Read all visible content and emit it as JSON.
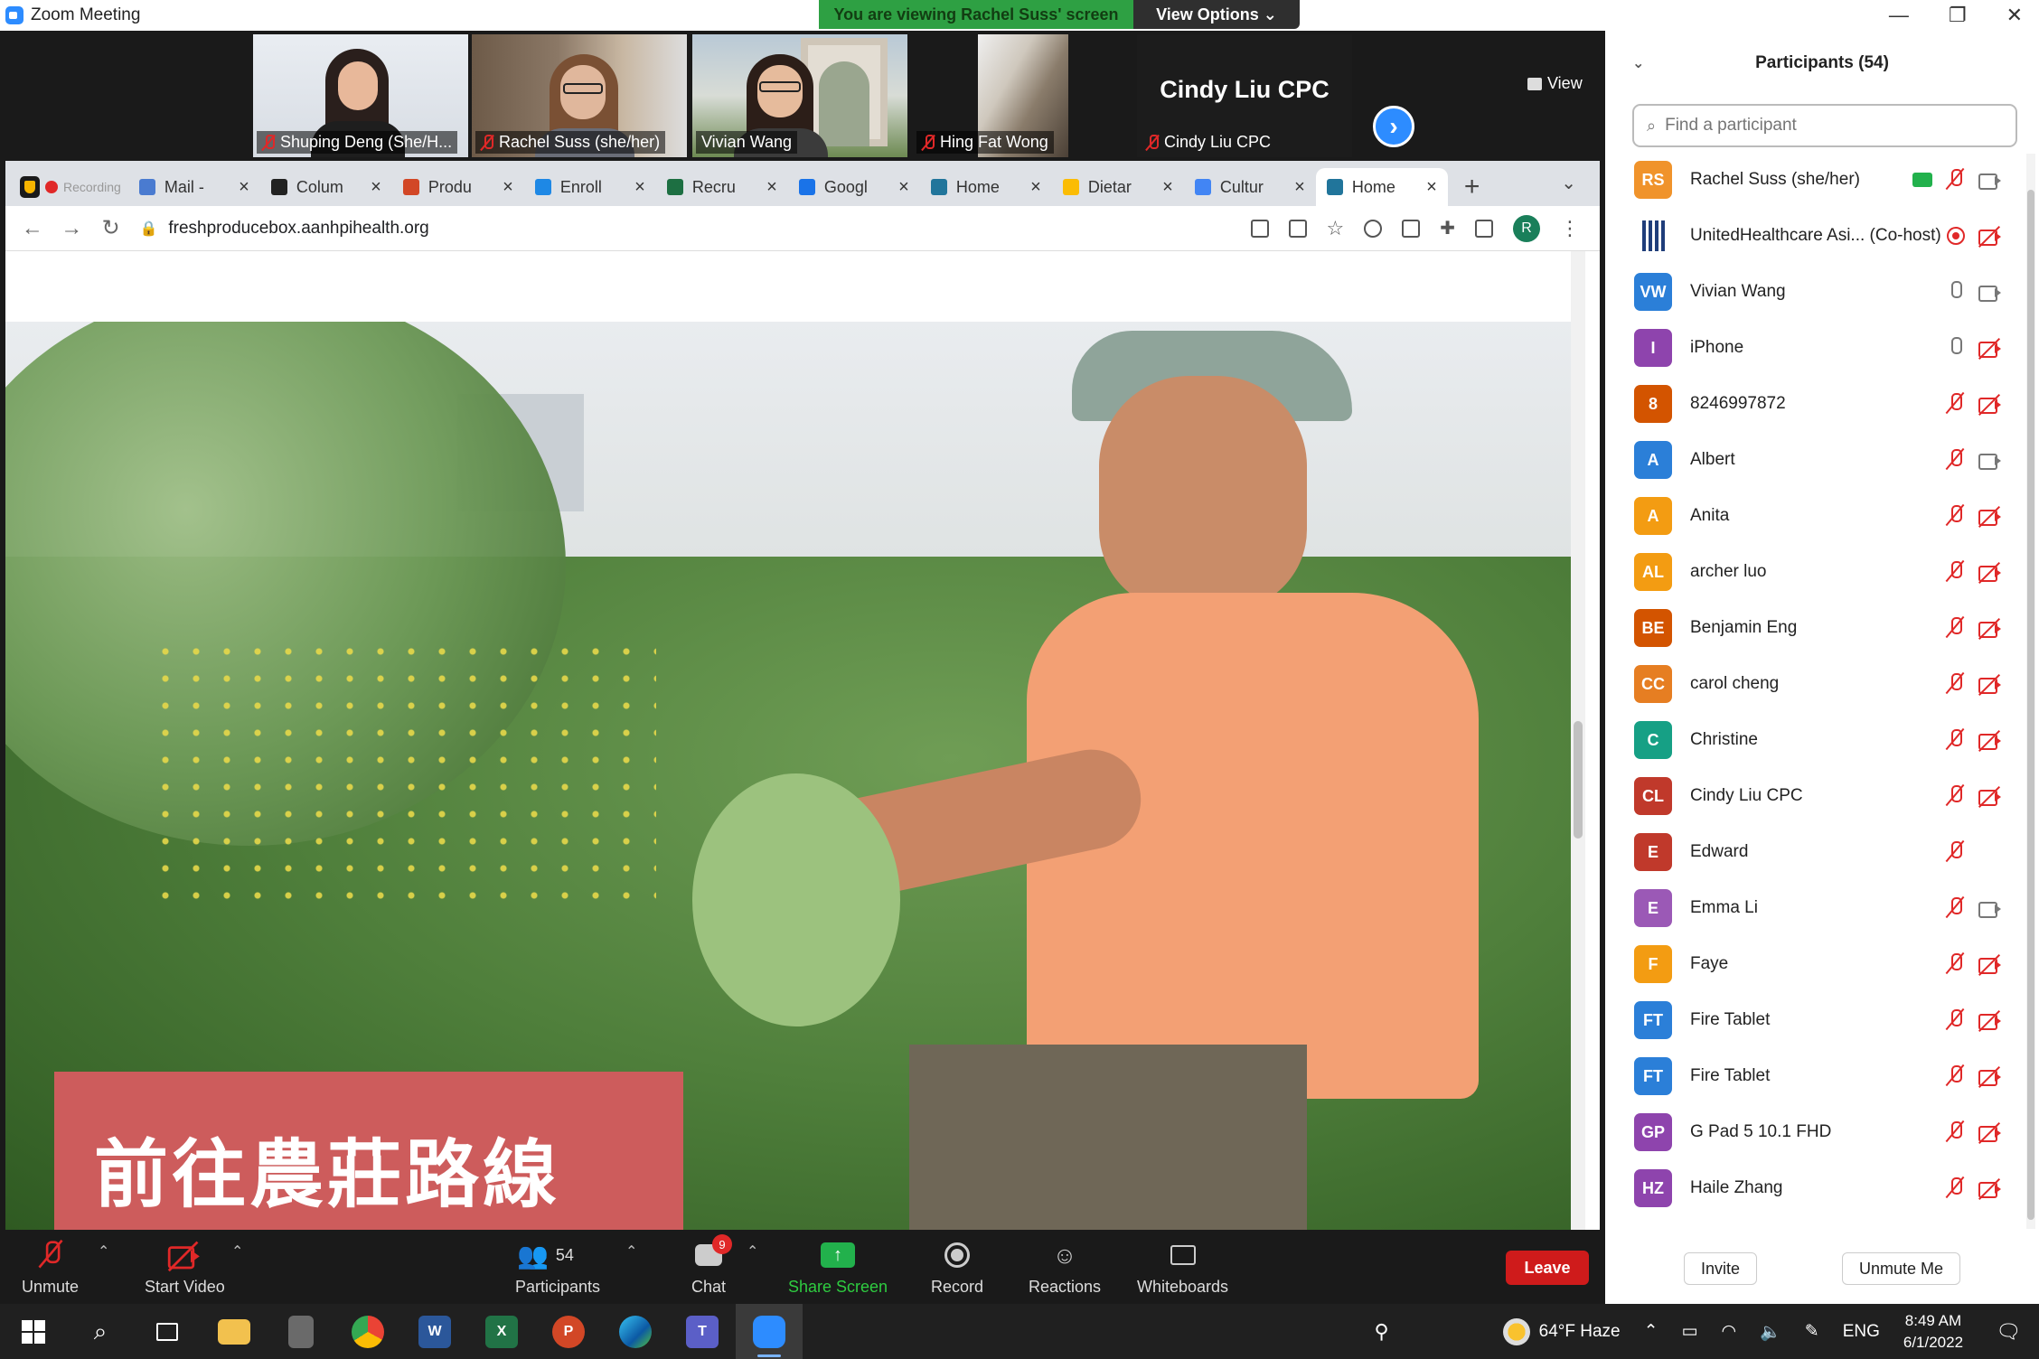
{
  "window": {
    "title": "Zoom Meeting"
  },
  "banner": {
    "viewing": "You are viewing Rachel Suss' screen",
    "view_options": "View Options ⌄"
  },
  "strip": {
    "view_label": "View",
    "tiles": [
      {
        "name": "Shuping Deng (She/H...",
        "active": false
      },
      {
        "name": "Rachel Suss (she/her)",
        "active": false
      },
      {
        "name": "Vivian Wang",
        "active": true
      },
      {
        "name": "Hing Fat Wong",
        "active": false
      },
      {
        "name": "Cindy Liu CPC",
        "big": "Cindy Liu CPC",
        "active": false
      }
    ]
  },
  "browser": {
    "tabs": [
      {
        "label": "Mail -",
        "color": "#4a7bd0"
      },
      {
        "label": "Colum",
        "color": "#222222"
      },
      {
        "label": "Produ",
        "color": "#d24726"
      },
      {
        "label": "Enroll",
        "color": "#1e88e5"
      },
      {
        "label": "Recru",
        "color": "#1d6f42"
      },
      {
        "label": "Googl",
        "color": "#1a73e8"
      },
      {
        "label": "Home",
        "color": "#21759b"
      },
      {
        "label": "Dietar",
        "color": "#fbbc04"
      },
      {
        "label": "Cultur",
        "color": "#4285f4"
      },
      {
        "label": "Home",
        "color": "#21759b",
        "active": true
      }
    ],
    "recording_label": "Recording",
    "url": "freshproducebox.aanhpihealth.org",
    "profile_initial": "R",
    "banner_text": "前往農莊路線"
  },
  "toolbar": {
    "unmute": "Unmute",
    "start_video": "Start Video",
    "participants_count": "54",
    "participants": "Participants",
    "chat": "Chat",
    "chat_badge": "9",
    "share_screen": "Share Screen",
    "record": "Record",
    "reactions": "Reactions",
    "whiteboards": "Whiteboards",
    "leave": "Leave"
  },
  "panel": {
    "title": "Participants (54)",
    "search_placeholder": "Find a participant",
    "invite": "Invite",
    "unmute_me": "Unmute Me",
    "participants": [
      {
        "initials": "RS",
        "name": "Rachel Suss (she/her)",
        "color": "#f0932b",
        "share": true,
        "mic": "muted",
        "cam": "on"
      },
      {
        "initials": "",
        "name": "UnitedHealthcare Asi...  (Co-host)",
        "color": "#1f3d7a",
        "rec": true,
        "mic": "none",
        "cam": "off"
      },
      {
        "initials": "VW",
        "name": "Vivian Wang",
        "color": "#2b7fd8",
        "mic": "on",
        "cam": "on"
      },
      {
        "initials": "I",
        "name": "iPhone",
        "color": "#8e44ad",
        "mic": "on",
        "cam": "off"
      },
      {
        "initials": "8",
        "name": "8246997872",
        "color": "#d35400",
        "mic": "muted",
        "cam": "off"
      },
      {
        "initials": "A",
        "name": "Albert",
        "color": "#2b7fd8",
        "mic": "muted",
        "cam": "on"
      },
      {
        "initials": "A",
        "name": "Anita",
        "color": "#f39c12",
        "mic": "muted",
        "cam": "off"
      },
      {
        "initials": "AL",
        "name": "archer luo",
        "color": "#f39c12",
        "mic": "muted",
        "cam": "off"
      },
      {
        "initials": "BE",
        "name": "Benjamin Eng",
        "color": "#d35400",
        "mic": "muted",
        "cam": "off"
      },
      {
        "initials": "CC",
        "name": "carol cheng",
        "color": "#e67e22",
        "mic": "muted",
        "cam": "off"
      },
      {
        "initials": "C",
        "name": "Christine",
        "color": "#16a085",
        "mic": "muted",
        "cam": "off"
      },
      {
        "initials": "CL",
        "name": "Cindy Liu CPC",
        "color": "#c0392b",
        "mic": "muted",
        "cam": "off"
      },
      {
        "initials": "E",
        "name": "Edward",
        "color": "#c0392b",
        "mic": "muted",
        "cam": "none"
      },
      {
        "initials": "E",
        "name": "Emma Li",
        "color": "#9b59b6",
        "mic": "muted",
        "cam": "on"
      },
      {
        "initials": "F",
        "name": "Faye",
        "color": "#f39c12",
        "mic": "muted",
        "cam": "off"
      },
      {
        "initials": "FT",
        "name": "Fire Tablet",
        "color": "#2b7fd8",
        "mic": "muted",
        "cam": "off"
      },
      {
        "initials": "FT",
        "name": "Fire Tablet",
        "color": "#2b7fd8",
        "mic": "muted",
        "cam": "off"
      },
      {
        "initials": "GP",
        "name": "G Pad 5 10.1 FHD",
        "color": "#8e44ad",
        "mic": "muted",
        "cam": "off"
      },
      {
        "initials": "HZ",
        "name": "Haile Zhang",
        "color": "#8e44ad",
        "mic": "muted",
        "cam": "off"
      }
    ]
  },
  "taskbar": {
    "weather": "64°F  Haze",
    "lang": "ENG",
    "time": "8:49 AM",
    "date": "6/1/2022"
  },
  "colors": {
    "zoom_blue": "#2d8cff",
    "green_banner": "#2ea043",
    "leave_red": "#cf1b1b"
  }
}
